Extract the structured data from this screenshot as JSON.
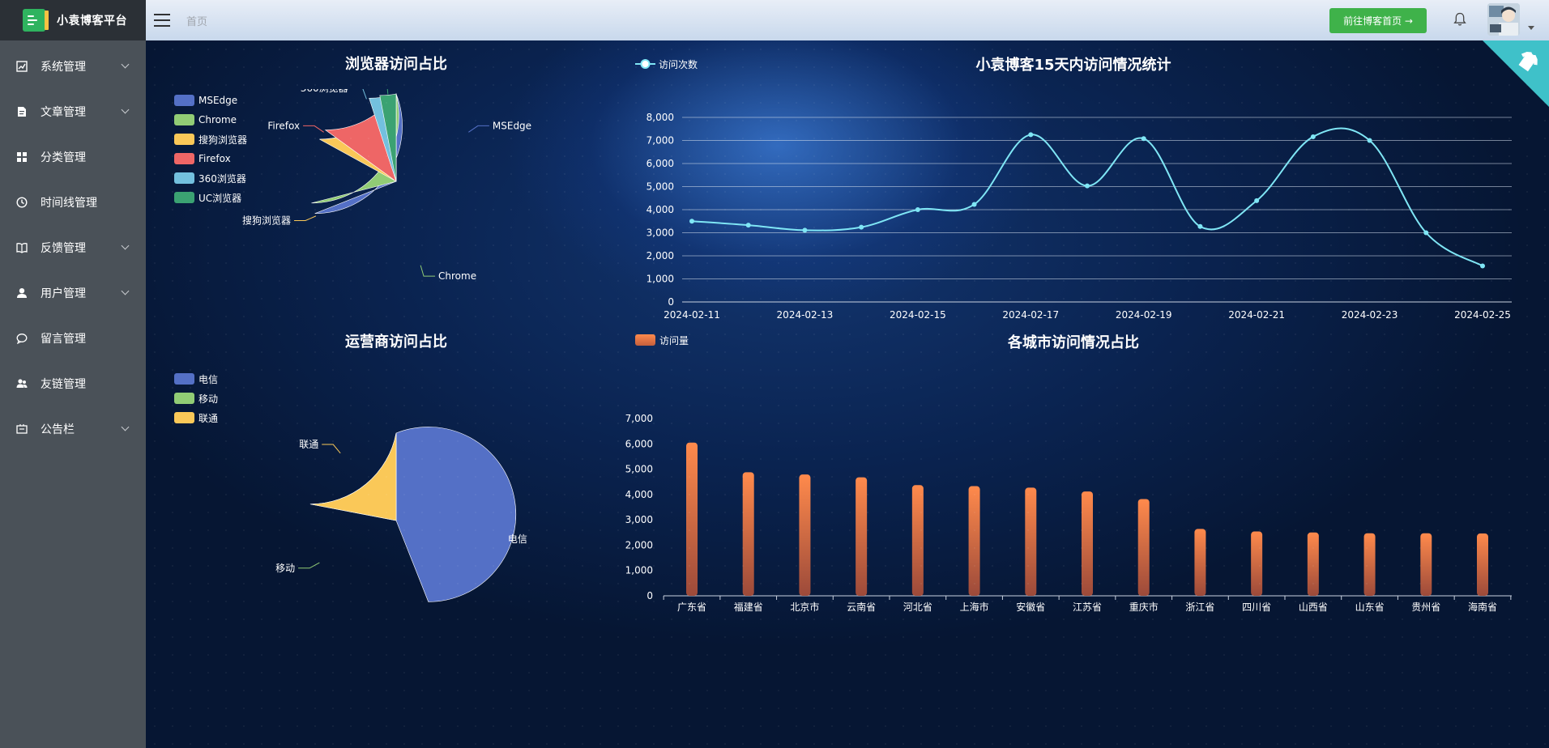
{
  "app": {
    "title": "小袁博客平台"
  },
  "header": {
    "breadcrumb": "首页",
    "goto_button": "前往博客首页 →"
  },
  "sidebar": {
    "items": [
      {
        "label": "系统管理",
        "icon": "chart-line-icon",
        "has_submenu": true
      },
      {
        "label": "文章管理",
        "icon": "document-icon",
        "has_submenu": true
      },
      {
        "label": "分类管理",
        "icon": "grid-icon",
        "has_submenu": false
      },
      {
        "label": "时间线管理",
        "icon": "clock-icon",
        "has_submenu": false
      },
      {
        "label": "反馈管理",
        "icon": "book-icon",
        "has_submenu": true
      },
      {
        "label": "用户管理",
        "icon": "user-icon",
        "has_submenu": true
      },
      {
        "label": "留言管理",
        "icon": "chat-icon",
        "has_submenu": false
      },
      {
        "label": "友链管理",
        "icon": "users-icon",
        "has_submenu": false
      },
      {
        "label": "公告栏",
        "icon": "notice-icon",
        "has_submenu": true
      }
    ]
  },
  "chart_data": [
    {
      "id": "browser",
      "type": "pie",
      "title": "浏览器访问占比",
      "legend_position": "top-left",
      "categories": [
        "MSEdge",
        "Chrome",
        "搜狗浏览器",
        "Firefox",
        "360浏览器",
        "UC浏览器"
      ],
      "values": [
        31,
        29,
        17,
        15,
        5,
        3
      ],
      "colors": [
        "#5470c6",
        "#91cc75",
        "#fac858",
        "#ee6666",
        "#73c0de",
        "#3ba272"
      ]
    },
    {
      "id": "visits",
      "type": "line",
      "legend": "访问次数",
      "title": "小袁博客15天内访问情况统计",
      "x": [
        "2024-02-11",
        "2024-02-12",
        "2024-02-13",
        "2024-02-14",
        "2024-02-15",
        "2024-02-16",
        "2024-02-17",
        "2024-02-18",
        "2024-02-19",
        "2024-02-20",
        "2024-02-21",
        "2024-02-22",
        "2024-02-23",
        "2024-02-24",
        "2024-02-25"
      ],
      "x_tick_labels": [
        "2024-02-11",
        "2024-02-13",
        "2024-02-15",
        "2024-02-17",
        "2024-02-19",
        "2024-02-21",
        "2024-02-23",
        "2024-02-25"
      ],
      "values": [
        3500,
        3330,
        3110,
        3240,
        4000,
        4230,
        7250,
        5030,
        7080,
        3270,
        4390,
        7160,
        7000,
        3000,
        1560
      ],
      "ylim": [
        0,
        8000
      ],
      "y_ticks": [
        0,
        1000,
        2000,
        3000,
        4000,
        5000,
        6000,
        7000,
        8000
      ],
      "grid": true,
      "color": "#7fe6f5"
    },
    {
      "id": "carrier",
      "type": "pie",
      "title": "运营商访问占比",
      "legend_position": "top-left",
      "categories": [
        "电信",
        "移动",
        "联通"
      ],
      "values": [
        56,
        22,
        22
      ],
      "colors": [
        "#5470c6",
        "#91cc75",
        "#fac858"
      ]
    },
    {
      "id": "city",
      "type": "bar",
      "legend": "访问量",
      "title": "各城市访问情况占比",
      "categories": [
        "广东省",
        "福建省",
        "北京市",
        "云南省",
        "河北省",
        "上海市",
        "安徽省",
        "江苏省",
        "重庆市",
        "浙江省",
        "四川省",
        "山西省",
        "山东省",
        "贵州省",
        "海南省"
      ],
      "values": [
        6050,
        4880,
        4790,
        4680,
        4370,
        4330,
        4270,
        4120,
        3820,
        2640,
        2540,
        2500,
        2470,
        2470,
        2460
      ],
      "ylim": [
        0,
        7000
      ],
      "y_ticks": [
        0,
        1000,
        2000,
        3000,
        4000,
        5000,
        6000,
        7000
      ],
      "grid": false,
      "color_top": "#ff8a4c",
      "color_bottom": "#9c4a3a"
    }
  ]
}
